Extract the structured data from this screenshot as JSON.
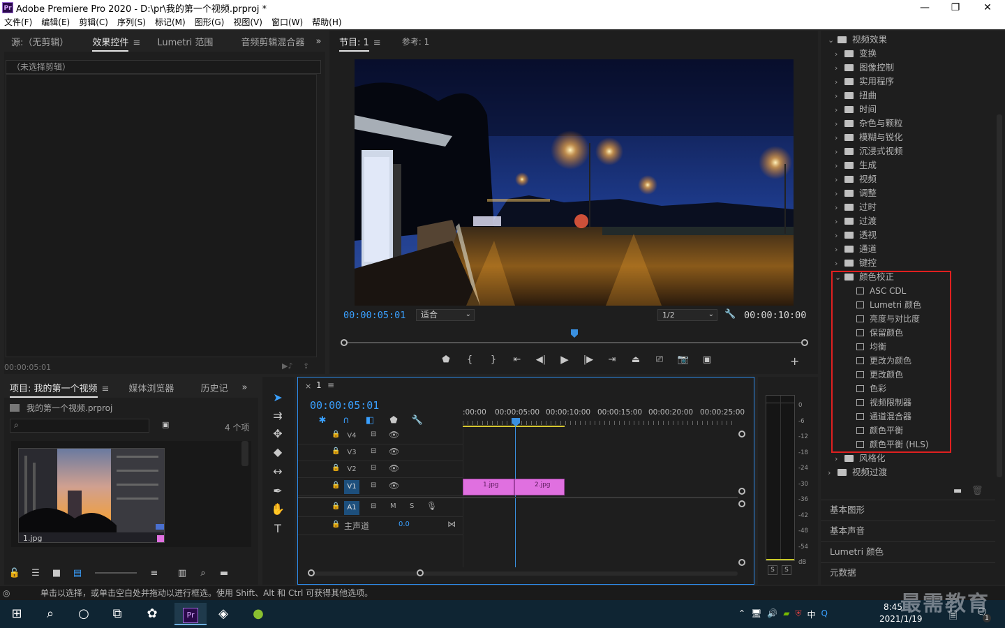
{
  "window": {
    "title": "Adobe Premiere Pro 2020 - D:\\pr\\我的第一个视频.prproj *",
    "icon_label": "Pr",
    "buttons": {
      "minimize": "—",
      "maximize": "❐",
      "close": "✕"
    }
  },
  "menu": [
    "文件(F)",
    "编辑(E)",
    "剪辑(C)",
    "序列(S)",
    "标记(M)",
    "图形(G)",
    "视图(V)",
    "窗口(W)",
    "帮助(H)"
  ],
  "effect_controls": {
    "tabs": {
      "source": "源:（无剪辑）",
      "effect_controls": "效果控件",
      "lumetri_scopes": "Lumetri 范围",
      "audio_mixer": "音频剪辑混合器"
    },
    "no_clip": "（未选择剪辑）",
    "timecode": "00:00:05:01"
  },
  "program": {
    "tabs": {
      "program": "节目: 1",
      "reference": "参考: 1"
    },
    "timecode_current": "00:00:05:01",
    "fit": "适合",
    "resolution": "1/2",
    "timecode_duration": "00:00:10:00",
    "playhead_fraction": 0.5
  },
  "project": {
    "tabs": {
      "project": "项目: 我的第一个视频",
      "media_browser": "媒体浏览器",
      "history": "历史记"
    },
    "file": "我的第一个视频.prproj",
    "item_count": "4 个项",
    "search_placeholder": "",
    "thumb_label": "1.jpg"
  },
  "timeline": {
    "sequence": "1",
    "timecode": "00:00:05:01",
    "ruler": [
      ":00:00",
      "00:00:05:00",
      "00:00:10:00",
      "00:00:15:00",
      "00:00:20:00",
      "00:00:25:00"
    ],
    "video_tracks": [
      "V4",
      "V3",
      "V2",
      "V1"
    ],
    "audio_tracks": [
      "A1"
    ],
    "master": {
      "label": "主声道",
      "value": "0.0"
    },
    "audio_controls": {
      "mute": "M",
      "solo": "S"
    },
    "clips": [
      "1.jpg",
      "2.jpg"
    ]
  },
  "meter": {
    "scale": [
      "0",
      "-6",
      "-12",
      "-18",
      "-24",
      "-30",
      "-36",
      "-42",
      "-48",
      "-54",
      "dB"
    ],
    "solo": [
      "S",
      "S"
    ]
  },
  "effects": {
    "root": "视频效果",
    "categories": [
      "变换",
      "图像控制",
      "实用程序",
      "扭曲",
      "时间",
      "杂色与颗粒",
      "模糊与锐化",
      "沉浸式视频",
      "生成",
      "视频",
      "调整",
      "过时",
      "过渡",
      "透视",
      "通道",
      "键控"
    ],
    "expanded": "颜色校正",
    "color_correction": [
      "ASC CDL",
      "Lumetri 颜色",
      "亮度与对比度",
      "保留颜色",
      "均衡",
      "更改为颜色",
      "更改颜色",
      "色彩",
      "视频限制器",
      "通道混合器",
      "颜色平衡",
      "颜色平衡 (HLS)"
    ],
    "after": "风格化",
    "transitions": "视频过渡"
  },
  "side_panels": [
    "基本图形",
    "基本声音",
    "Lumetri 颜色",
    "元数据"
  ],
  "status": "单击以选择，或单击空白处并拖动以进行框选。使用 Shift、Alt 和 Ctrl 可获得其他选项。",
  "taskbar": {
    "time": "8:45",
    "date": "2021/1/19",
    "ime": "中",
    "watermark": "最需教育",
    "pr_label": "Pr",
    "notif_count": "1"
  }
}
